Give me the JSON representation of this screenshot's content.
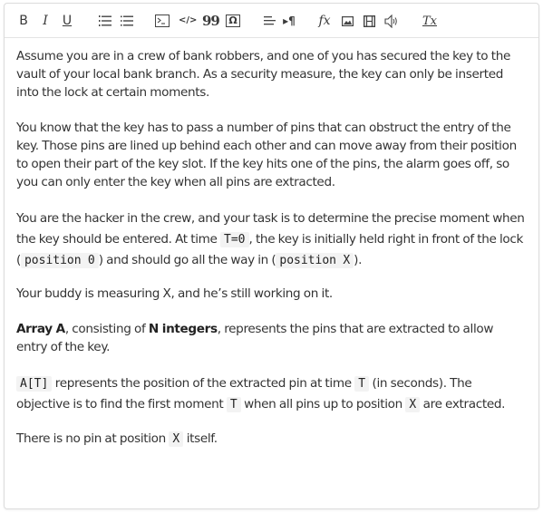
{
  "toolbar": {
    "buttons": [
      {
        "name": "bold",
        "label": "B"
      },
      {
        "name": "italic",
        "label": "I"
      },
      {
        "name": "underline",
        "label": "U"
      },
      {
        "name": "ordered-list",
        "label": ""
      },
      {
        "name": "bullet-list",
        "label": ""
      },
      {
        "name": "code-block",
        "label": ">_"
      },
      {
        "name": "inline-code",
        "label": "</>"
      },
      {
        "name": "blockquote",
        "label": "99"
      },
      {
        "name": "special-char",
        "label": "Ω"
      },
      {
        "name": "align",
        "label": ""
      },
      {
        "name": "text-direction",
        "label": "▸¶"
      },
      {
        "name": "formula",
        "label": "fx"
      },
      {
        "name": "image",
        "label": ""
      },
      {
        "name": "video",
        "label": ""
      },
      {
        "name": "audio",
        "label": ""
      },
      {
        "name": "clear-format",
        "label": "Tx"
      }
    ]
  },
  "content": {
    "p1": "Assume you are in a crew of bank robbers, and one of you has secured the key to the vault of your local bank branch. As a security measure, the key can only be inserted into the lock at certain moments.",
    "p2": "You know that the key has to pass a number of pins that can obstruct the entry of the key. Those pins are lined up behind each other and can move away from their position to open their part of the key slot. If the key hits one of the pins, the alarm goes off, so you can only enter the key when all pins are extracted.",
    "p3": {
      "a": "You are the hacker in the crew, and your task is to determine the precise moment when the key should be entered. At time ",
      "code1": "T=0",
      "b": ", the key is initially held right in front of the lock (",
      "code2": "position 0",
      "c": ") and should go all the way in (",
      "code3": "position X",
      "d": ")."
    },
    "p4": "Your buddy is measuring X, and he’s still working on it.",
    "p5": {
      "bold1": "Array A",
      "a": ", consisting of ",
      "bold2": "N integers",
      "b": ", represents the pins that are extracted to allow entry of the key."
    },
    "p6": {
      "code1": "A[T]",
      "a": " represents the position of the extracted pin at time ",
      "code2": "T",
      "b": " (in seconds). The objective is to find the first moment ",
      "code3": "T",
      "c": " when all pins up to position ",
      "code4": "X",
      "d": " are extracted."
    },
    "p7": {
      "a": "There is no pin at position ",
      "code1": "X",
      "b": " itself."
    }
  }
}
